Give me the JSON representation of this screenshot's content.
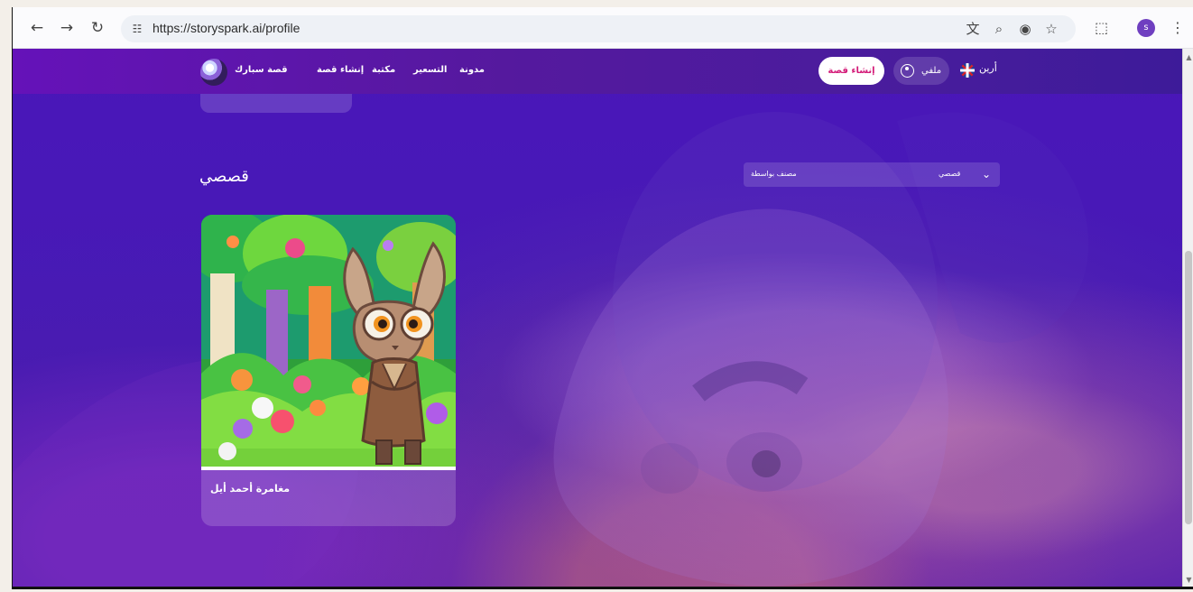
{
  "browser": {
    "url": "https://storyspark.ai/profile",
    "profile_initial": "s",
    "icons": {
      "back": "back-arrow-icon",
      "forward": "forward-arrow-icon",
      "reload": "reload-icon",
      "site_info": "site-settings-icon",
      "translate": "translate-icon",
      "zoom": "zoom-icon",
      "eye_off": "eye-off-icon",
      "star": "star-icon",
      "extensions": "puzzle-icon",
      "menu": "more-icon"
    }
  },
  "site": {
    "brand": "قصة سبارك",
    "nav_links": [
      "إنشاء قصة",
      "مكتبة",
      "التسعير",
      "مدونة"
    ],
    "create_button": "إنشاء قصة",
    "profile_label": "ملفي",
    "language": "أرين"
  },
  "page": {
    "title": "قصصي",
    "sort_label": "مصنف بواسطة",
    "sort_value": "قصصي"
  },
  "stories": [
    {
      "title": "مغامرة أحمد أيل"
    }
  ],
  "colors": {
    "primary_purple": "#6512b9",
    "accent_pink": "#d31b78"
  }
}
